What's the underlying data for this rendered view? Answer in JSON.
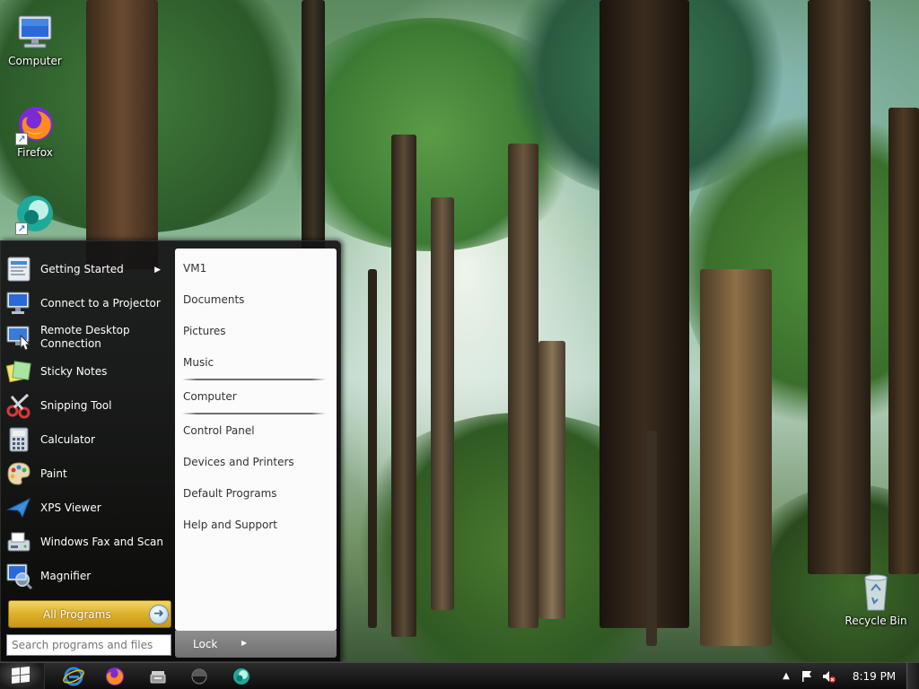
{
  "desktop": {
    "icons": [
      {
        "label": "Computer",
        "icon": "computer-icon"
      },
      {
        "label": "Firefox",
        "icon": "firefox-icon"
      },
      {
        "label": "",
        "icon": "teal-app-icon"
      },
      {
        "label": "Recycle Bin",
        "icon": "recycle-bin-icon"
      }
    ]
  },
  "start_menu": {
    "programs": [
      {
        "label": "Getting Started",
        "icon": "getting-started-icon",
        "has_submenu": true
      },
      {
        "label": "Connect to a Projector",
        "icon": "projector-icon"
      },
      {
        "label": "Remote Desktop Connection",
        "icon": "remote-desktop-icon"
      },
      {
        "label": "Sticky Notes",
        "icon": "sticky-notes-icon"
      },
      {
        "label": "Snipping Tool",
        "icon": "snipping-tool-icon"
      },
      {
        "label": "Calculator",
        "icon": "calculator-icon"
      },
      {
        "label": "Paint",
        "icon": "paint-icon"
      },
      {
        "label": "XPS Viewer",
        "icon": "xps-viewer-icon"
      },
      {
        "label": "Windows Fax and Scan",
        "icon": "fax-scan-icon"
      },
      {
        "label": "Magnifier",
        "icon": "magnifier-icon"
      }
    ],
    "all_programs_label": "All Programs",
    "search_placeholder": "Search programs and files",
    "right_items": [
      {
        "label": "VM1"
      },
      {
        "label": "Documents"
      },
      {
        "label": "Pictures"
      },
      {
        "label": "Music"
      },
      {
        "label": "Computer"
      },
      {
        "label": "Control Panel"
      },
      {
        "label": "Devices and Printers"
      },
      {
        "label": "Default Programs"
      },
      {
        "label": "Help and Support"
      }
    ],
    "lock_label": "Lock"
  },
  "taskbar": {
    "pinned": [
      {
        "icon": "internet-explorer-icon"
      },
      {
        "icon": "firefox-icon"
      },
      {
        "icon": "device-icon"
      },
      {
        "icon": "dark-circle-app-icon"
      },
      {
        "icon": "teal-app-icon"
      }
    ],
    "tray": [
      {
        "icon": "show-hidden-icons-icon"
      },
      {
        "icon": "action-center-flag-icon"
      },
      {
        "icon": "volume-muted-icon"
      }
    ],
    "clock": "8:19 PM"
  },
  "colors": {
    "start_menu_bg": "#111111",
    "all_programs_gold": "#dcb12a",
    "right_pane_bg": "#fbfbfb",
    "lock_bar": "#7f7f7f",
    "taskbar_bg": "#1a1a1a"
  }
}
